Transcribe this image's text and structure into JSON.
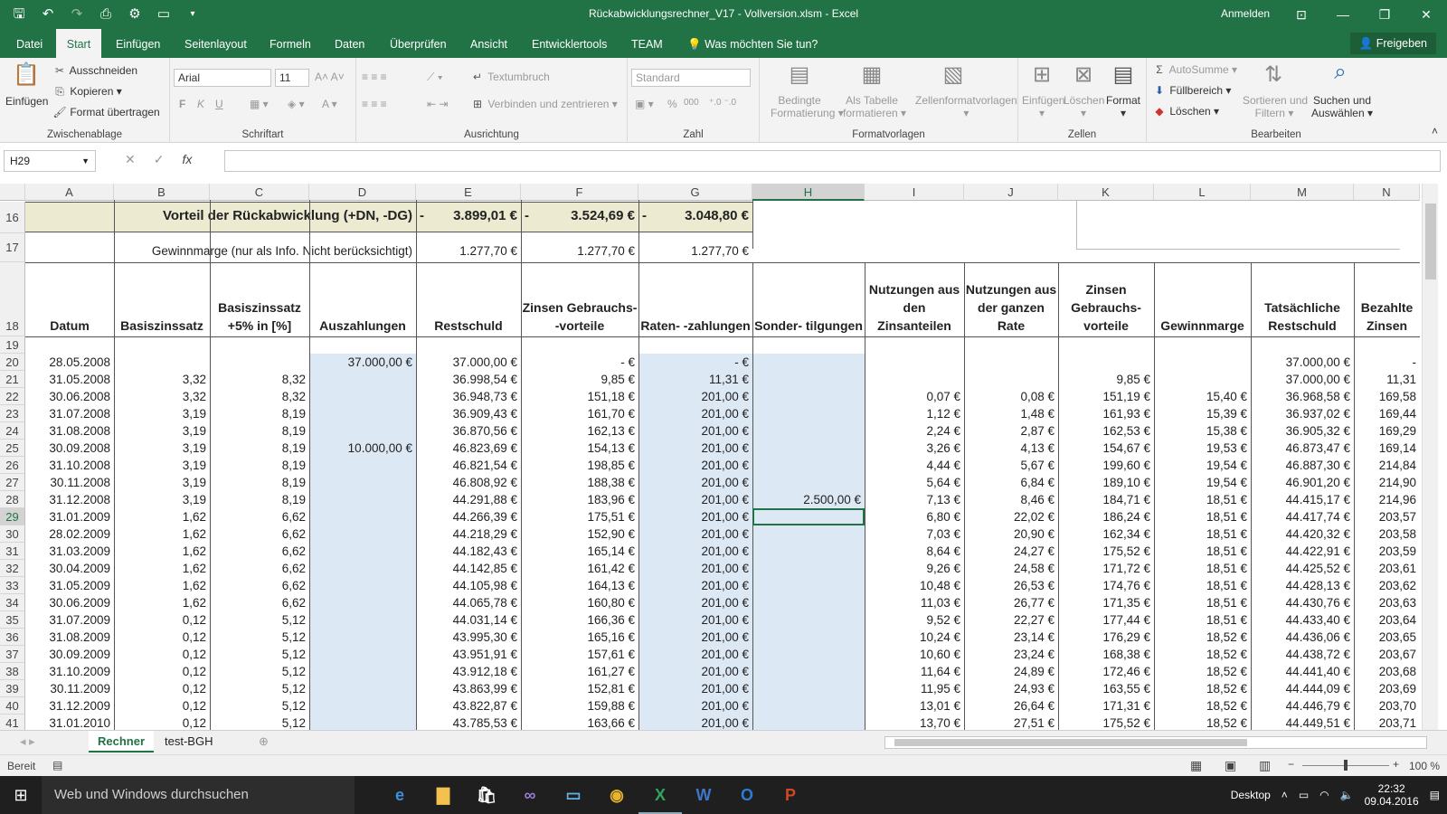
{
  "window": {
    "title": "Rückabwicklungsrechner_V17 - Vollversion.xlsm - Excel",
    "signin": "Anmelden"
  },
  "quick_access": [
    "save-icon",
    "undo-icon",
    "redo-icon",
    "print-preview-icon",
    "macro-icon",
    "new-file-icon",
    "customize-icon"
  ],
  "menu": {
    "tabs": [
      "Datei",
      "Start",
      "Einfügen",
      "Seitenlayout",
      "Formeln",
      "Daten",
      "Überprüfen",
      "Ansicht",
      "Entwicklertools",
      "TEAM"
    ],
    "active": "Start",
    "tellme": "Was möchten Sie tun?",
    "share": "Freigeben"
  },
  "ribbon": {
    "clipboard": {
      "paste": "Einfügen",
      "cut": "Ausschneiden",
      "copy": "Kopieren",
      "format_painter": "Format übertragen",
      "label": "Zwischenablage"
    },
    "font": {
      "name": "Arial",
      "size": "11",
      "label": "Schriftart",
      "bold": "F",
      "italic": "K",
      "underline": "U"
    },
    "alignment": {
      "wrap": "Textumbruch",
      "merge": "Verbinden und zentrieren",
      "label": "Ausrichtung"
    },
    "number": {
      "format": "Standard",
      "percent": "%",
      "thousands": "000",
      "label": "Zahl"
    },
    "styles": {
      "conditional_l1": "Bedingte",
      "conditional_l2": "Formatierung",
      "table_l1": "Als Tabelle",
      "table_l2": "formatieren",
      "cellstyles": "Zellenformatvorlagen",
      "label": "Formatvorlagen"
    },
    "cells": {
      "insert": "Einfügen",
      "delete": "Löschen",
      "format": "Format",
      "label": "Zellen"
    },
    "editing": {
      "autosum": "AutoSumme",
      "fill": "Füllbereich",
      "clear": "Löschen",
      "sort_l1": "Sortieren und",
      "sort_l2": "Filtern",
      "find_l1": "Suchen und",
      "find_l2": "Auswählen",
      "label": "Bearbeiten"
    }
  },
  "formula_bar": {
    "name_box": "H29",
    "formula": "",
    "cancel": "✕",
    "enter": "✓",
    "fx": "fx"
  },
  "columns": [
    "A",
    "B",
    "C",
    "D",
    "E",
    "F",
    "G",
    "H",
    "I",
    "J",
    "K",
    "L",
    "M",
    "N"
  ],
  "selected_column": "H",
  "selected_row": "29",
  "sheet": {
    "row16": {
      "label": "Vorteil der Rückabwicklung (+DN, -DG)",
      "e_sign": "-",
      "e": "3.899,01 €",
      "f_sign": "-",
      "f": "3.524,69 €",
      "g_sign": "-",
      "g": "3.048,80 €"
    },
    "row17": {
      "label": "Gewinnmarge (nur als Info. Nicht berücksichtigt)",
      "e": "1.277,70 €",
      "f": "1.277,70 €",
      "g": "1.277,70 €"
    },
    "headers": {
      "A": "Datum",
      "B": "Basiszinssatz",
      "C": "Basiszinssatz +5% in [%]",
      "D": "Auszahlungen",
      "E": "Restschuld",
      "F": "Zinsen Gebrauchs- -vorteile",
      "G": "Raten- -zahlungen",
      "H": "Sonder- tilgungen",
      "I": "Nutzungen aus den Zinsanteilen",
      "J": "Nutzungen aus der ganzen Rate",
      "K": "Zinsen Gebrauchs- vorteile",
      "L": "Gewinnmarge",
      "M": "Tatsächliche Restschuld",
      "N": "Bezahlte Zinsen"
    },
    "rows": [
      [
        "20",
        "28.05.2008",
        "",
        "",
        "37.000,00 €",
        "37.000,00 €",
        "-      €",
        "-      €",
        "",
        "",
        "",
        "",
        "",
        "37.000,00 €",
        "-"
      ],
      [
        "21",
        "31.05.2008",
        "3,32",
        "8,32",
        "",
        "36.998,54 €",
        "9,85 €",
        "11,31 €",
        "",
        "",
        "",
        "9,85 €",
        "",
        "37.000,00 €",
        "11,31"
      ],
      [
        "22",
        "30.06.2008",
        "3,32",
        "8,32",
        "",
        "36.948,73 €",
        "151,18 €",
        "201,00 €",
        "",
        "0,07 €",
        "0,08 €",
        "151,19 €",
        "15,40 €",
        "36.968,58 €",
        "169,58"
      ],
      [
        "23",
        "31.07.2008",
        "3,19",
        "8,19",
        "",
        "36.909,43 €",
        "161,70 €",
        "201,00 €",
        "",
        "1,12 €",
        "1,48 €",
        "161,93 €",
        "15,39 €",
        "36.937,02 €",
        "169,44"
      ],
      [
        "24",
        "31.08.2008",
        "3,19",
        "8,19",
        "",
        "36.870,56 €",
        "162,13 €",
        "201,00 €",
        "",
        "2,24 €",
        "2,87 €",
        "162,53 €",
        "15,38 €",
        "36.905,32 €",
        "169,29"
      ],
      [
        "25",
        "30.09.2008",
        "3,19",
        "8,19",
        "10.000,00 €",
        "46.823,69 €",
        "154,13 €",
        "201,00 €",
        "",
        "3,26 €",
        "4,13 €",
        "154,67 €",
        "19,53 €",
        "46.873,47 €",
        "169,14"
      ],
      [
        "26",
        "31.10.2008",
        "3,19",
        "8,19",
        "",
        "46.821,54 €",
        "198,85 €",
        "201,00 €",
        "",
        "4,44 €",
        "5,67 €",
        "199,60 €",
        "19,54 €",
        "46.887,30 €",
        "214,84"
      ],
      [
        "27",
        "30.11.2008",
        "3,19",
        "8,19",
        "",
        "46.808,92 €",
        "188,38 €",
        "201,00 €",
        "",
        "5,64 €",
        "6,84 €",
        "189,10 €",
        "19,54 €",
        "46.901,20 €",
        "214,90"
      ],
      [
        "28",
        "31.12.2008",
        "3,19",
        "8,19",
        "",
        "44.291,88 €",
        "183,96 €",
        "201,00 €",
        "2.500,00 €",
        "7,13 €",
        "8,46 €",
        "184,71 €",
        "18,51 €",
        "44.415,17 €",
        "214,96"
      ],
      [
        "29",
        "31.01.2009",
        "1,62",
        "6,62",
        "",
        "44.266,39 €",
        "175,51 €",
        "201,00 €",
        "",
        "6,80 €",
        "22,02 €",
        "186,24 €",
        "18,51 €",
        "44.417,74 €",
        "203,57"
      ],
      [
        "30",
        "28.02.2009",
        "1,62",
        "6,62",
        "",
        "44.218,29 €",
        "152,90 €",
        "201,00 €",
        "",
        "7,03 €",
        "20,90 €",
        "162,34 €",
        "18,51 €",
        "44.420,32 €",
        "203,58"
      ],
      [
        "31",
        "31.03.2009",
        "1,62",
        "6,62",
        "",
        "44.182,43 €",
        "165,14 €",
        "201,00 €",
        "",
        "8,64 €",
        "24,27 €",
        "175,52 €",
        "18,51 €",
        "44.422,91 €",
        "203,59"
      ],
      [
        "32",
        "30.04.2009",
        "1,62",
        "6,62",
        "",
        "44.142,85 €",
        "161,42 €",
        "201,00 €",
        "",
        "9,26 €",
        "24,58 €",
        "171,72 €",
        "18,51 €",
        "44.425,52 €",
        "203,61"
      ],
      [
        "33",
        "31.05.2009",
        "1,62",
        "6,62",
        "",
        "44.105,98 €",
        "164,13 €",
        "201,00 €",
        "",
        "10,48 €",
        "26,53 €",
        "174,76 €",
        "18,51 €",
        "44.428,13 €",
        "203,62"
      ],
      [
        "34",
        "30.06.2009",
        "1,62",
        "6,62",
        "",
        "44.065,78 €",
        "160,80 €",
        "201,00 €",
        "",
        "11,03 €",
        "26,77 €",
        "171,35 €",
        "18,51 €",
        "44.430,76 €",
        "203,63"
      ],
      [
        "35",
        "31.07.2009",
        "0,12",
        "5,12",
        "",
        "44.031,14 €",
        "166,36 €",
        "201,00 €",
        "",
        "9,52 €",
        "22,27 €",
        "177,44 €",
        "18,51 €",
        "44.433,40 €",
        "203,64"
      ],
      [
        "36",
        "31.08.2009",
        "0,12",
        "5,12",
        "",
        "43.995,30 €",
        "165,16 €",
        "201,00 €",
        "",
        "10,24 €",
        "23,14 €",
        "176,29 €",
        "18,52 €",
        "44.436,06 €",
        "203,65"
      ],
      [
        "37",
        "30.09.2009",
        "0,12",
        "5,12",
        "",
        "43.951,91 €",
        "157,61 €",
        "201,00 €",
        "",
        "10,60 €",
        "23,24 €",
        "168,38 €",
        "18,52 €",
        "44.438,72 €",
        "203,67"
      ],
      [
        "38",
        "31.10.2009",
        "0,12",
        "5,12",
        "",
        "43.912,18 €",
        "161,27 €",
        "201,00 €",
        "",
        "11,64 €",
        "24,89 €",
        "172,46 €",
        "18,52 €",
        "44.441,40 €",
        "203,68"
      ],
      [
        "39",
        "30.11.2009",
        "0,12",
        "5,12",
        "",
        "43.863,99 €",
        "152,81 €",
        "201,00 €",
        "",
        "11,95 €",
        "24,93 €",
        "163,55 €",
        "18,52 €",
        "44.444,09 €",
        "203,69"
      ],
      [
        "40",
        "31.12.2009",
        "0,12",
        "5,12",
        "",
        "43.822,87 €",
        "159,88 €",
        "201,00 €",
        "",
        "13,01 €",
        "26,64 €",
        "171,31 €",
        "18,52 €",
        "44.446,79 €",
        "203,70"
      ],
      [
        "41",
        "31.01.2010",
        "0,12",
        "5,12",
        "",
        "43.785,53 €",
        "163,66 €",
        "201,00 €",
        "",
        "13,70 €",
        "27,51 €",
        "175,52 €",
        "18,52 €",
        "44.449,51 €",
        "203,71"
      ]
    ]
  },
  "sheet_tabs": [
    "Rechner",
    "test-BGH"
  ],
  "active_sheet": "Rechner",
  "status": {
    "ready": "Bereit",
    "zoom": "100 %"
  },
  "taskbar": {
    "search": "Web und Windows durchsuchen",
    "desktop": "Desktop",
    "time": "22:32",
    "date": "09.04.2016",
    "apps": [
      "edge-icon",
      "file-explorer-icon",
      "store-icon",
      "visual-studio-icon",
      "remote-desktop-icon",
      "chrome-icon",
      "excel-icon",
      "word-icon",
      "outlook-icon",
      "powerpoint-icon"
    ]
  }
}
